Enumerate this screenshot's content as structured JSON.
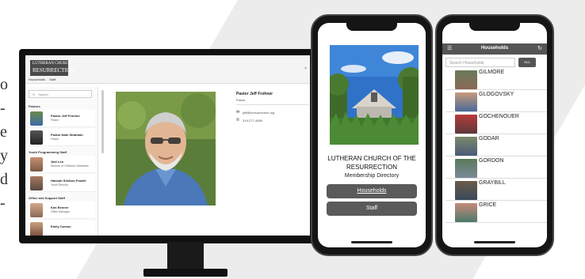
{
  "left_text": [
    "o",
    "-",
    "e",
    "y",
    "d",
    "-"
  ],
  "desktop": {
    "logo_top": "LUTHERAN CHURCH",
    "logo_main": "RESURRECTION",
    "logo_bottom": "OF THE",
    "nav": [
      "Households",
      "Staff"
    ],
    "close": "×",
    "search_placeholder": "Search",
    "search_icon": "search-icon",
    "sections": [
      "Pastors",
      "Youth Programming Staff",
      "Office and Support Staff"
    ],
    "people": [
      {
        "name": "Pastor Jeff Frohner",
        "role": "Pastor"
      },
      {
        "name": "Pastor Nate Stratman",
        "role": "Pastor"
      },
      {
        "name": "Jael Leo",
        "role": "Director of Childrens Ministries"
      },
      {
        "name": "Hannah Shelton-Powell",
        "role": "Youth Director"
      },
      {
        "name": "Kim Renner",
        "role": "Office Manager"
      },
      {
        "name": "Emily Carson",
        "role": ""
      }
    ],
    "detail": {
      "name": "Pastor Jeff Frohner",
      "role": "Pastor",
      "email": "jeff@lcresurrection.org",
      "phone": "319-277-4688"
    }
  },
  "phone1": {
    "title": "LUTHERAN CHURCH OF THE RESURRECTION",
    "subtitle": "Membership Directory",
    "buttons": [
      "Households",
      "Staff"
    ]
  },
  "phone2": {
    "header": "Households",
    "search_placeholder": "Search Households",
    "all_label": "ALL",
    "households": [
      "GILMORE",
      "GLOGOVSKY",
      "GOCHENOUER",
      "GODAR",
      "GORDON",
      "GRAYBILL",
      "GRICE"
    ]
  },
  "colors": {
    "dark_button": "#5a5a5a",
    "header_bar": "#555555",
    "monitor_frame": "#111111"
  }
}
